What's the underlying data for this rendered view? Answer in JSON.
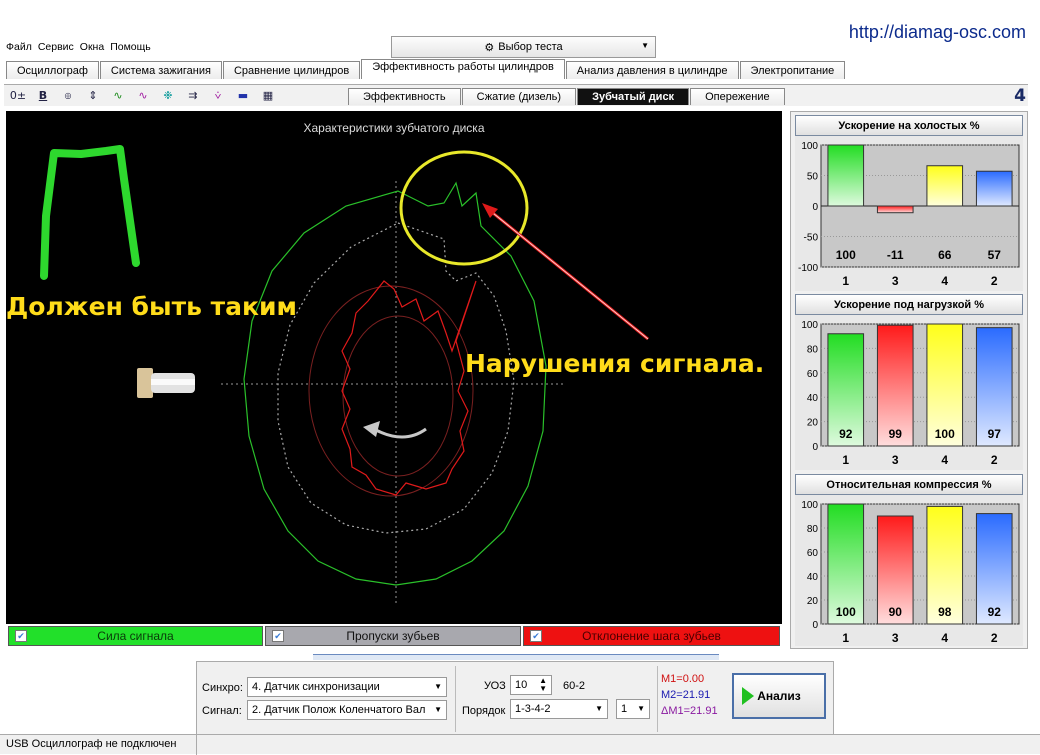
{
  "url": "http://diamag-osc.com",
  "menu": [
    "Файл",
    "Сервис",
    "Окна",
    "Помощь"
  ],
  "test_select": "Выбор теста",
  "main_tabs": [
    "Осциллограф",
    "Система зажигания",
    "Сравнение цилиндров",
    "Эффективность работы цилиндров",
    "Анализ давления в цилиндре",
    "Электропитание"
  ],
  "main_tab_active": 3,
  "sub_tabs": [
    "Эффективность",
    "Сжатие (дизель)",
    "Зубчатый диск",
    "Опережение"
  ],
  "sub_tab_active": 2,
  "side_number": "4",
  "canvas": {
    "title": "Характеристики зубчатого диска",
    "annotation_left": "Должен быть таким",
    "annotation_right": "Нарушения сигнала."
  },
  "checkboxes": [
    {
      "label": "Сила сигнала",
      "checked": true,
      "color": "#22e02a"
    },
    {
      "label": "Пропуски зубьев",
      "checked": true,
      "color": "#a8a8ae"
    },
    {
      "label": "Отклонение шага зубьев",
      "checked": true,
      "color": "#ee1111"
    }
  ],
  "charts": [
    {
      "title": "Ускорение на холостых %",
      "type": "bar",
      "categories": [
        "1",
        "3",
        "4",
        "2"
      ],
      "values": [
        100,
        -11,
        66,
        57
      ],
      "ylim": [
        -100,
        100
      ],
      "yticks": [
        "100",
        "50",
        "0",
        "-50",
        "-100"
      ]
    },
    {
      "title": "Ускорение под нагрузкой %",
      "type": "bar",
      "categories": [
        "1",
        "3",
        "4",
        "2"
      ],
      "values": [
        92,
        99,
        100,
        97
      ],
      "ylim": [
        0,
        100
      ],
      "yticks": [
        "100",
        "80",
        "60",
        "40",
        "20",
        "0"
      ]
    },
    {
      "title": "Относительная компрессия %",
      "type": "bar",
      "categories": [
        "1",
        "3",
        "4",
        "2"
      ],
      "values": [
        100,
        90,
        98,
        92
      ],
      "ylim": [
        0,
        100
      ],
      "yticks": [
        "100",
        "80",
        "60",
        "40",
        "20",
        "0"
      ]
    }
  ],
  "bar_colors": [
    "#22dd22",
    "#ff1a1a",
    "#ffff1a",
    "#2a6bff"
  ],
  "bottom": {
    "sync_label": "Синхро:",
    "sync_value": "4.  Датчик синхронизации",
    "signal_label": "Сигнал:",
    "signal_value": "2.  Датчик Полож Коленчатого Вал",
    "uoz_label": "УОЗ",
    "uoz_value": "10",
    "teeth": "60-2",
    "order_label": "Порядок",
    "order_value": "1-3-4-2",
    "order_num": "1",
    "m1": "M1=0.00",
    "m2": "M2=21.91",
    "dm1": "ΔM1=21.91",
    "analyze": "Анализ"
  },
  "status": "USB Осциллограф не подключен"
}
